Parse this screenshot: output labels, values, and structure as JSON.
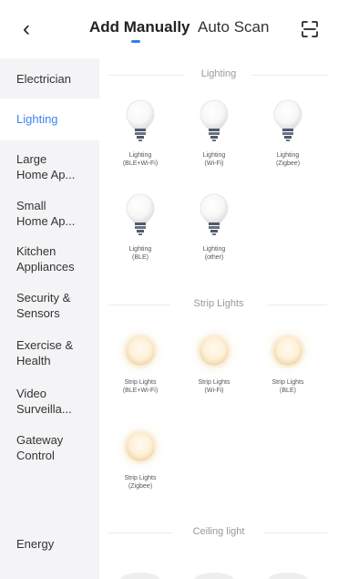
{
  "header": {
    "back_icon": "chevron-left-icon",
    "tabs": [
      {
        "label": "Add Manually",
        "active": true
      },
      {
        "label": "Auto Scan",
        "active": false
      }
    ],
    "scan_icon": "scan-icon",
    "active_tab_color": "#2f80ed"
  },
  "sidebar": {
    "items": [
      {
        "label": "Electrician"
      },
      {
        "label": "Lighting",
        "active": true
      },
      {
        "label": "Large\nHome Ap..."
      },
      {
        "label": "Small\nHome Ap..."
      },
      {
        "label": "Kitchen\nAppliances"
      },
      {
        "label": "Security &\nSensors"
      },
      {
        "label": "Exercise &\nHealth"
      },
      {
        "label": "Video\nSurveilla..."
      },
      {
        "label": "Gateway\nControl"
      },
      {
        "label": "Energy"
      }
    ],
    "active_color": "#3d85f0",
    "active_bar_color": "#f39c32"
  },
  "sections": [
    {
      "title": "Lighting",
      "items": [
        {
          "label": "Lighting\n(BLE+Wi-Fi)",
          "icon": "bulb-icon"
        },
        {
          "label": "Lighting\n(Wi-Fi)",
          "icon": "bulb-icon"
        },
        {
          "label": "Lighting\n(Zigbee)",
          "icon": "bulb-icon"
        },
        {
          "label": "Lighting\n(BLE)",
          "icon": "bulb-icon"
        },
        {
          "label": "Lighting\n(other)",
          "icon": "bulb-icon"
        }
      ]
    },
    {
      "title": "Strip Lights",
      "items": [
        {
          "label": "Strip Lights\n(BLE+Wi-Fi)",
          "icon": "strip-light-icon"
        },
        {
          "label": "Strip Lights\n(Wi-Fi)",
          "icon": "strip-light-icon"
        },
        {
          "label": "Strip Lights\n(BLE)",
          "icon": "strip-light-icon"
        },
        {
          "label": "Strip Lights\n(Zigbee)",
          "icon": "strip-light-icon"
        }
      ]
    },
    {
      "title": "Ceiling light",
      "items": []
    }
  ]
}
